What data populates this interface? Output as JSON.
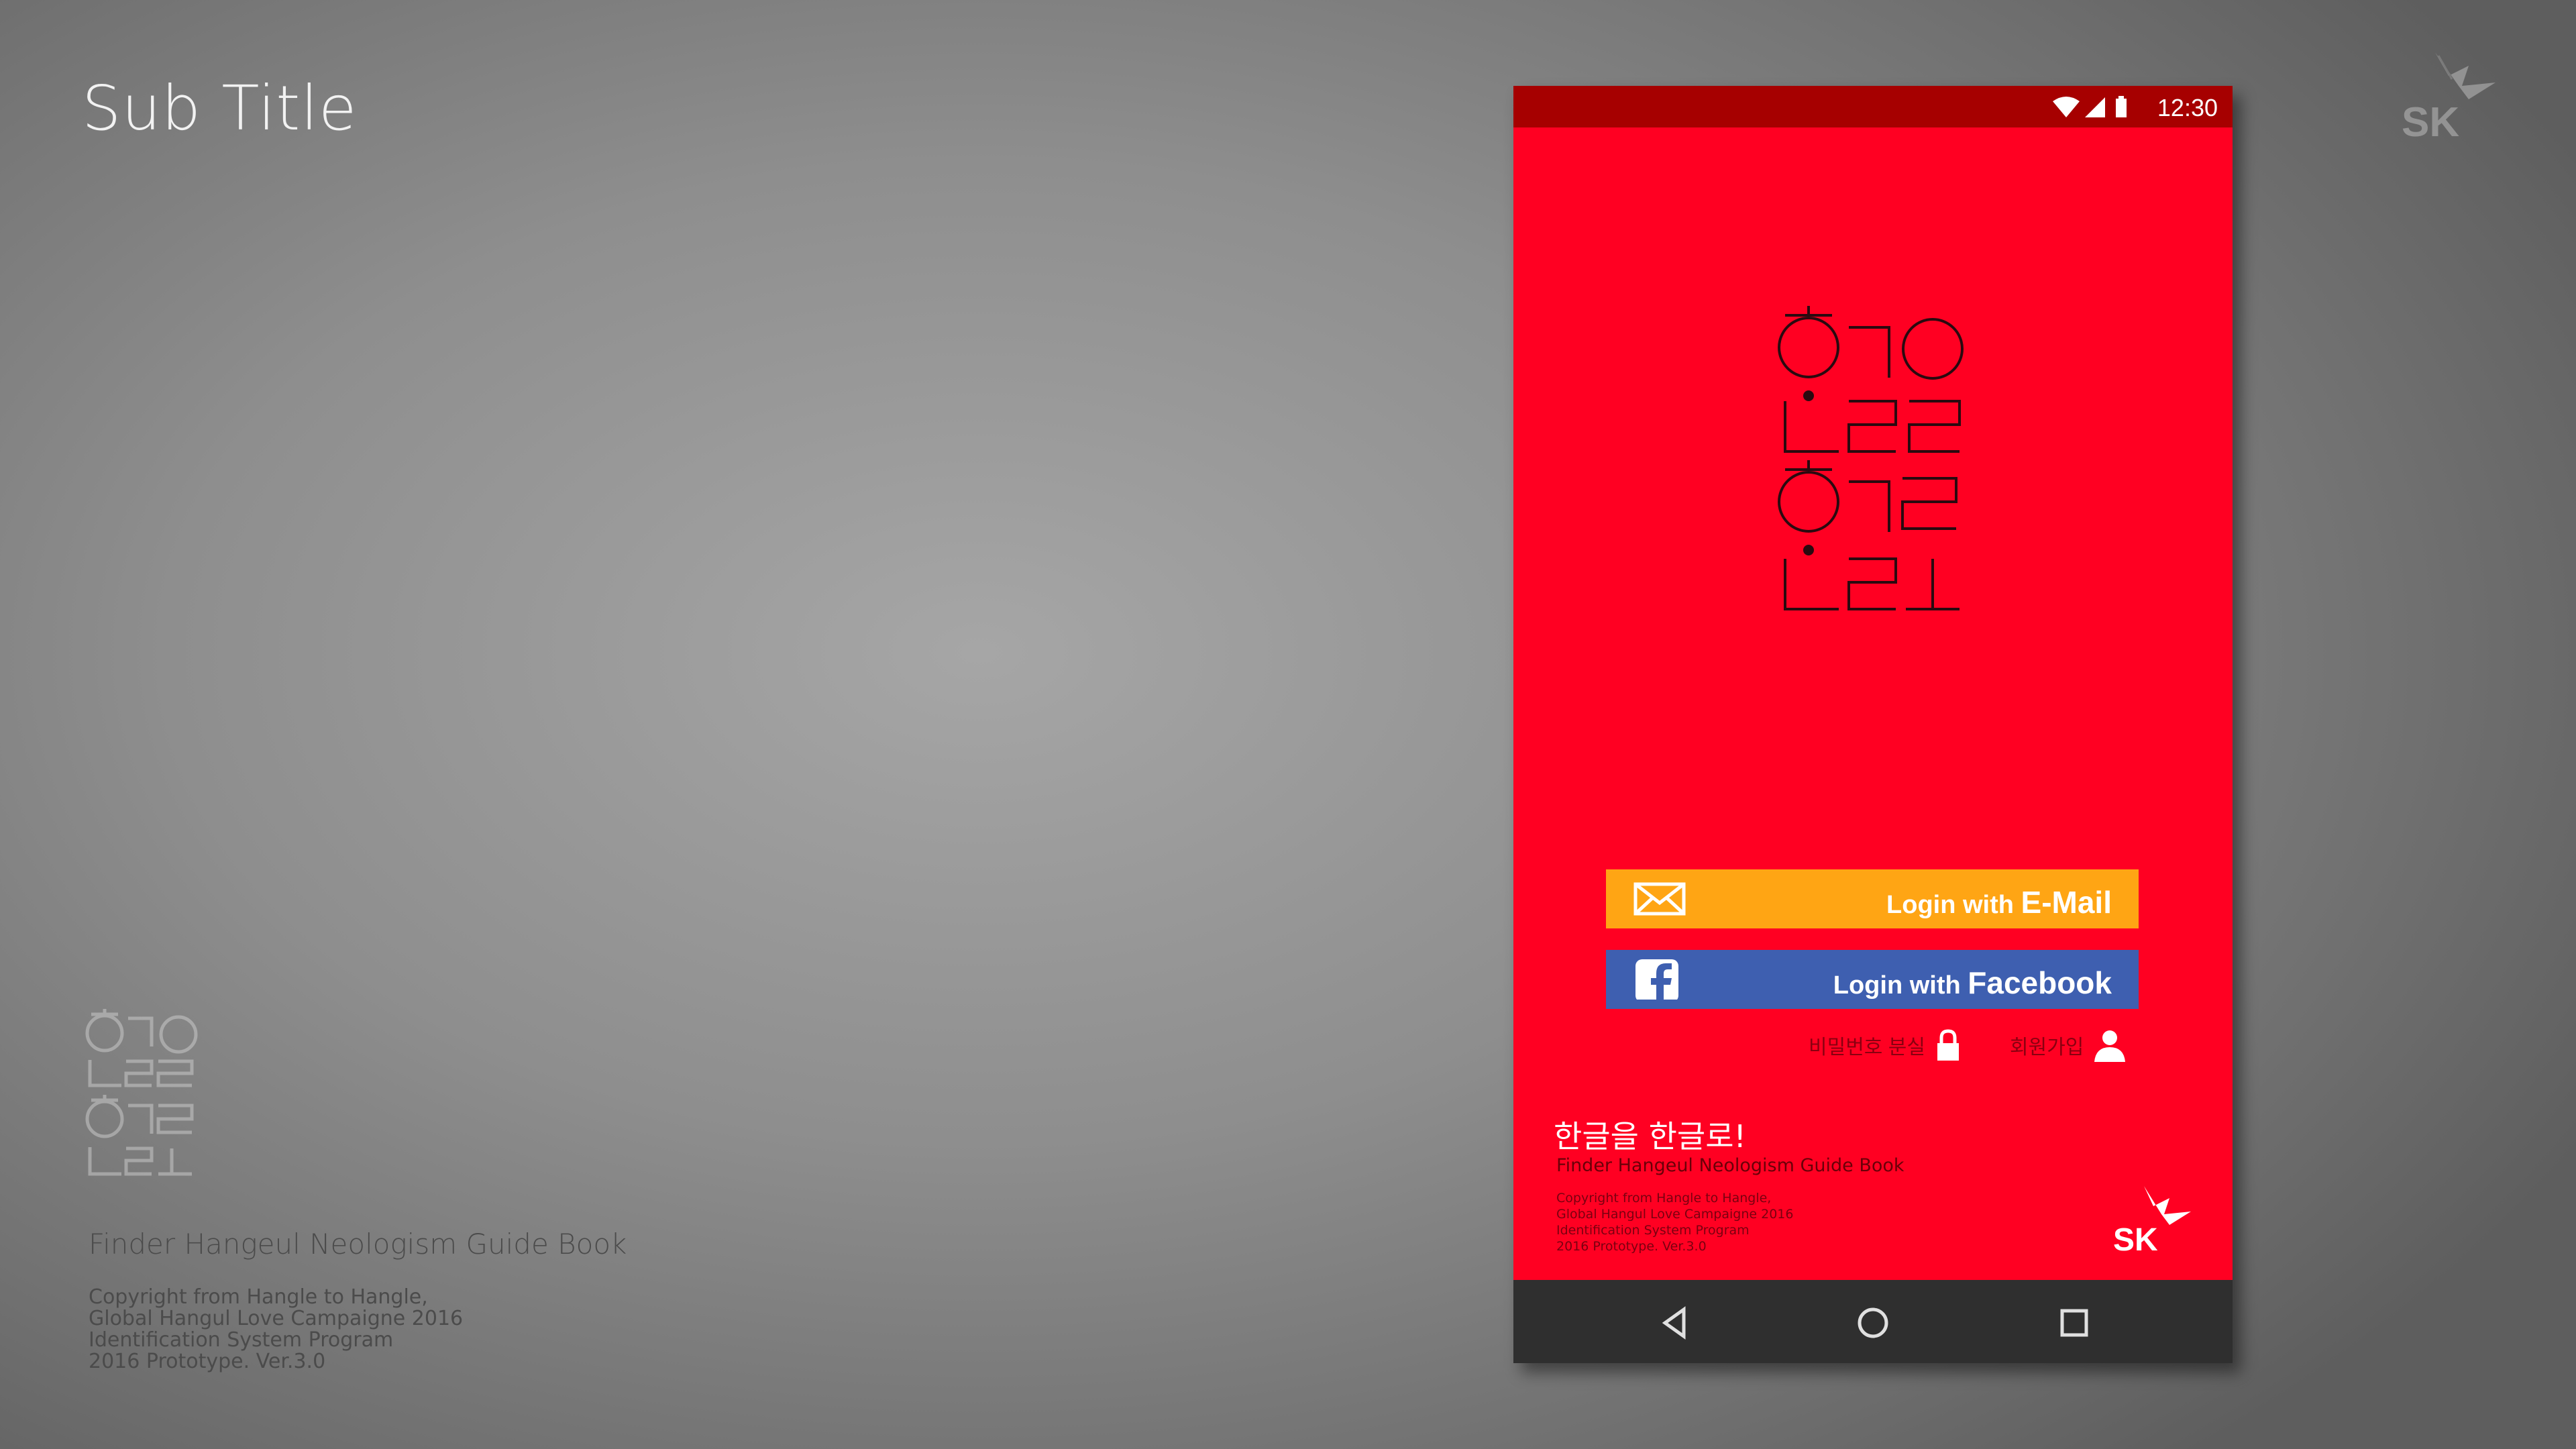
{
  "slide": {
    "sub_title": "Sub Title",
    "guide_title": "Finder Hangeul Neologism Guide Book",
    "copyright_lines": [
      "Copyright from Hangle to Hangle,",
      "Global Hangul Love Campaigne 2016",
      "Identification System Program",
      "2016 Prototype. Ver.3.0"
    ],
    "corner_logo_text": "SK"
  },
  "phone": {
    "status_time": "12:30",
    "buttons": {
      "email_prefix": "Login with ",
      "email_brand": "E-Mail",
      "facebook_prefix": "Login with ",
      "facebook_brand": "Facebook"
    },
    "links": {
      "forgot_password": "비밀번호 분실",
      "sign_up": "회원가입"
    },
    "footer": {
      "title": "한글을 한글로!",
      "subtitle": "Finder Hangeul Neologism Guide Book",
      "copyright_lines": [
        "Copyright from Hangle to Hangle,",
        "Global Hangul Love Campaigne 2016",
        "Identification System Program",
        "2016 Prototype. Ver.3.0"
      ],
      "logo_text": "SK"
    },
    "colors": {
      "background": "#ff0022",
      "status_bar": "#a60000",
      "email_button": "#ffa514",
      "facebook_button": "#3e5fb0",
      "nav_bar": "#2f2f2f"
    },
    "icons": [
      "wifi-icon",
      "signal-icon",
      "battery-icon",
      "mail-icon",
      "facebook-icon",
      "lock-icon",
      "user-icon",
      "back-icon",
      "home-icon",
      "recents-icon"
    ]
  }
}
